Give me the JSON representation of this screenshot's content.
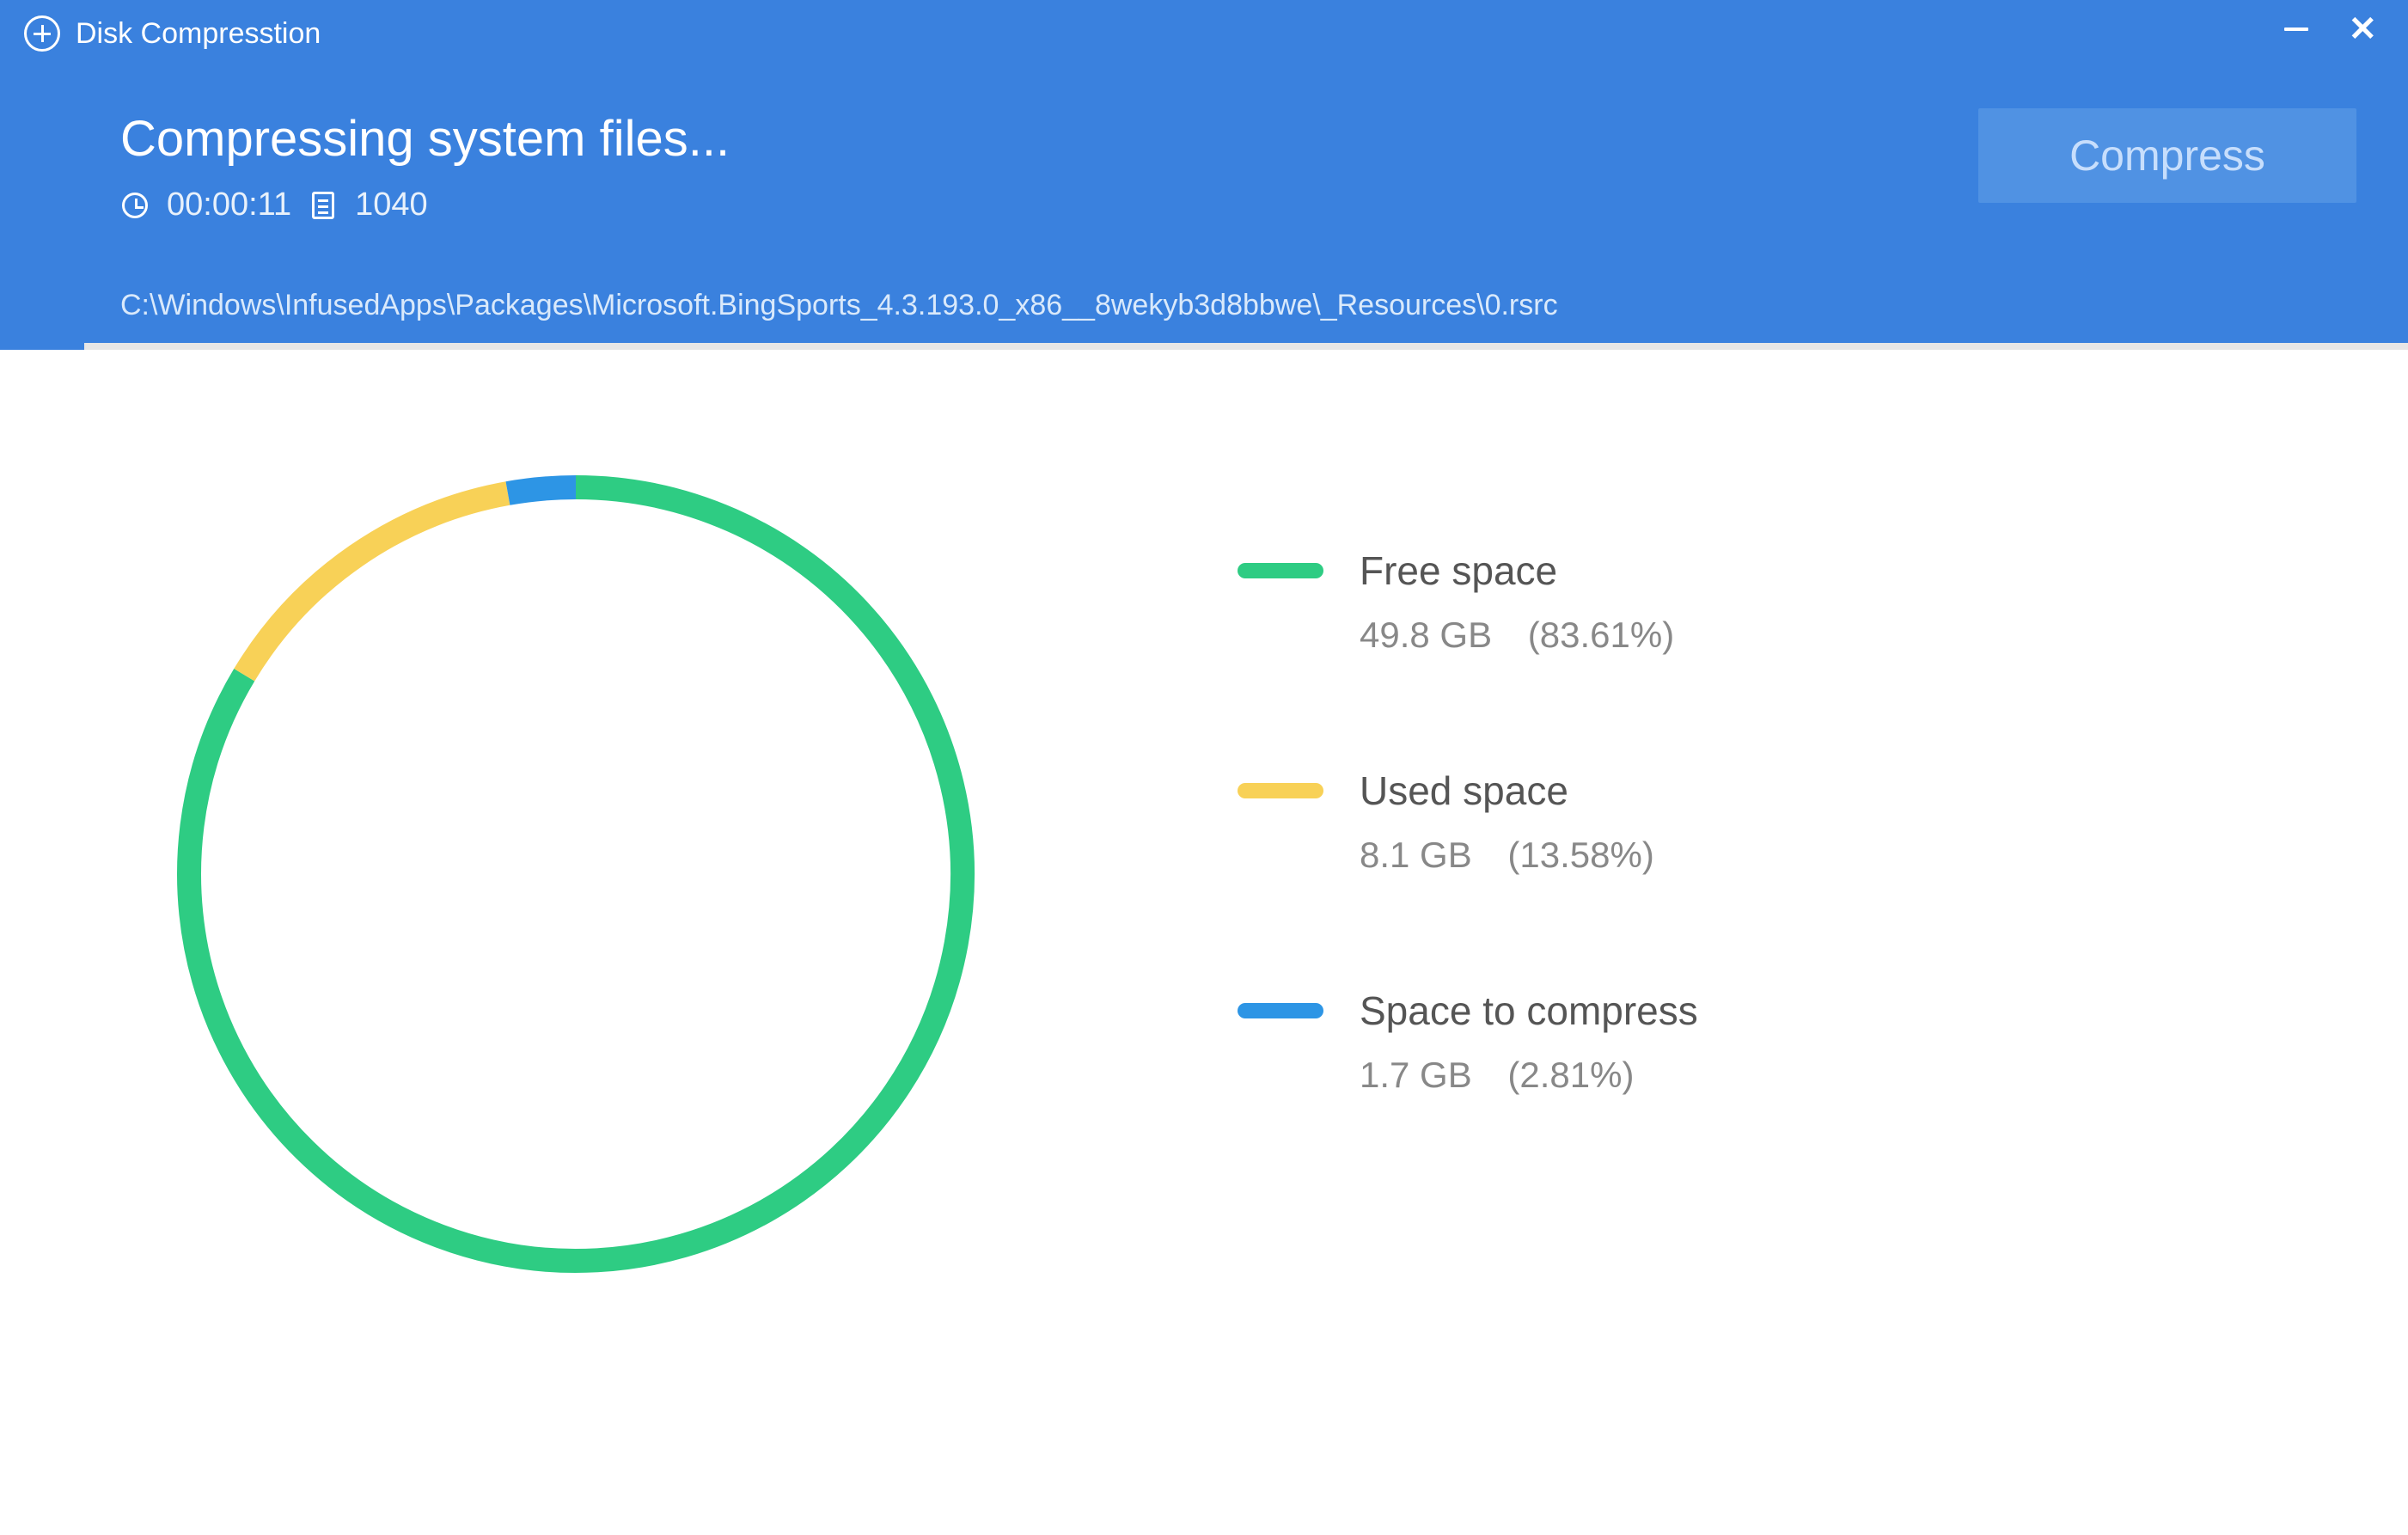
{
  "app": {
    "title": "Disk Compresstion"
  },
  "status": {
    "heading": "Compressing system files...",
    "elapsed": "00:00:11",
    "file_count": "1040",
    "compress_button": "Compress",
    "current_path": "C:\\Windows\\InfusedApps\\Packages\\Microsoft.BingSports_4.3.193.0_x86__8wekyb3d8bbwe\\_Resources\\0.rsrc",
    "progress_percent": 3.5
  },
  "colors": {
    "free": "#2ecc83",
    "used": "#f8d157",
    "compress": "#2d95e5"
  },
  "legend": {
    "items": [
      {
        "key": "free",
        "label": "Free space",
        "size": "49.8 GB",
        "percent": "(83.61%)"
      },
      {
        "key": "used",
        "label": "Used space",
        "size": "8.1 GB",
        "percent": "(13.58%)"
      },
      {
        "key": "compress",
        "label": "Space to compress",
        "size": "1.7 GB",
        "percent": "(2.81%)"
      }
    ]
  },
  "chart_data": {
    "type": "pie",
    "title": "",
    "series": [
      {
        "name": "Free space",
        "value": 83.61,
        "size_gb": 49.8,
        "color": "#2ecc83"
      },
      {
        "name": "Used space",
        "value": 13.58,
        "size_gb": 8.1,
        "color": "#f8d157"
      },
      {
        "name": "Space to compress",
        "value": 2.81,
        "size_gb": 1.7,
        "color": "#2d95e5"
      }
    ],
    "start_angle_deg": -90,
    "ring_stroke": 28,
    "ring_radius": 450
  }
}
